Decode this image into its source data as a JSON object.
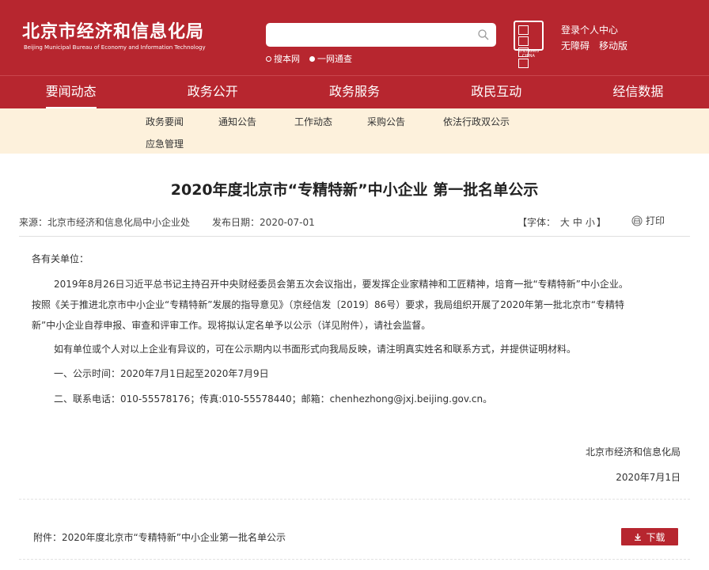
{
  "header": {
    "site_name": "北京市经济和信息化局",
    "site_name_en": "Beijing Municipal Bureau of Economy and Information Technology",
    "search": {
      "placeholder": "",
      "value": ""
    },
    "scope": [
      "搜本网",
      "一网通查"
    ],
    "links": {
      "login": "登录",
      "personal_center": "个人中心",
      "accessibility": "无障碍",
      "mobile": "移动版"
    },
    "emblem_caption": "ZHENGWU CHINA"
  },
  "nav": [
    "要闻动态",
    "政务公开",
    "政务服务",
    "政民互动",
    "经信数据"
  ],
  "subnav": {
    "row1": [
      "政务要闻",
      "通知公告",
      "工作动态",
      "采购公告",
      "依法行政双公示"
    ],
    "row2": [
      "应急管理"
    ]
  },
  "article": {
    "title": "2020年度北京市“专精特新”中小企业 第一批名单公示",
    "source_label": "来源：",
    "source": "北京市经济和信息化局中小企业处",
    "date_label": "发布日期：",
    "date": "2020-07-01",
    "font_label": "【字体：",
    "font_sizes": [
      "大",
      "中",
      "小"
    ],
    "font_end": "】",
    "print": "打印",
    "greeting": "各有关单位：",
    "para1_lines": [
      "2019年8月26日习近平总书记主持召开中央财经委员会第五次会议指出，要发挥企业家精神和工匠精神，培育一批“专精特新”中小企业。",
      "按照《关于推进北京市中小企业“专精特新”发展的指导意见》（京经信发〔2019〕86号）要求，我局组织开展了2020年第一批北京市“专精特",
      "新”中小企业自荐申报、审查和评审工作。现将拟认定名单予以公示（详见附件），请社会监督。"
    ],
    "para2": "如有单位或个人对以上企业有异议的，可在公示期内以书面形式向我局反映，请注明真实姓名和联系方式，并提供证明材料。",
    "para3": "一、公示时间：2020年7月1日起至2020年7月9日",
    "para4": "二、联系电话：010-55578176；传真:010-55578440；邮箱：chenhezhong@jxj.beijing.gov.cn。",
    "sign_org": "北京市经济和信息化局",
    "sign_date": "2020年7月1日",
    "attachment": "附件：2020年度北京市“专精特新”中小企业第一批名单公示",
    "download": "下载"
  },
  "colors": {
    "brand_red": "#b7262f",
    "subnav_bg": "#fdf1dc"
  }
}
